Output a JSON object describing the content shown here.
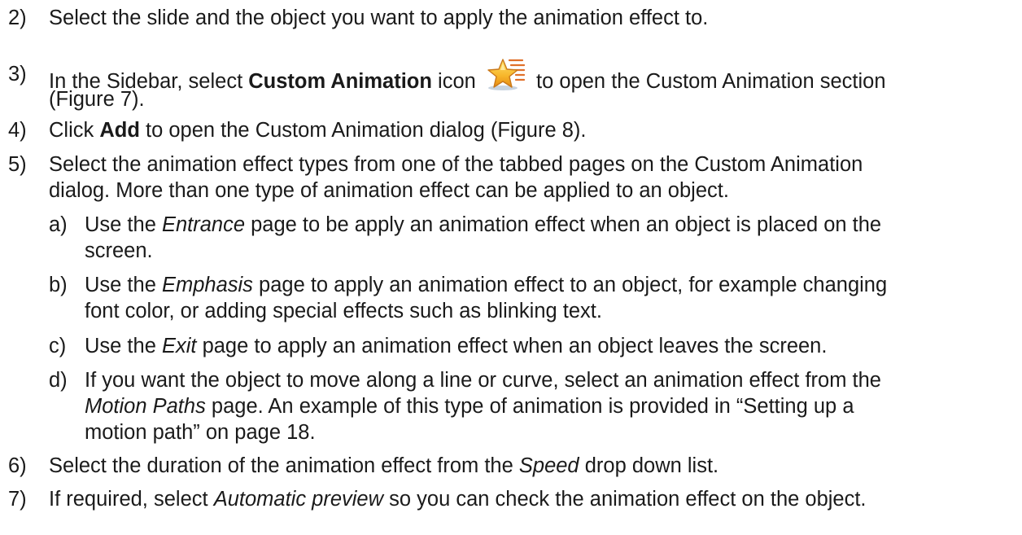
{
  "steps": [
    {
      "num": "2)",
      "text": "Select the slide and the object you want to apply the animation effect to."
    },
    {
      "num": "3)",
      "line1_a": "In the Sidebar, select ",
      "line1_b": "Custom Animation",
      "line1_c": " icon",
      "line1_d": "to open the Custom Animation section",
      "line2": "(Figure 7).",
      "icon": "custom-animation-star-icon"
    },
    {
      "num": "4)",
      "a": "Click ",
      "b": "Add",
      "c": " to open the Custom Animation dialog (Figure 8)."
    },
    {
      "num": "5)",
      "line1": "Select the animation effect types from one of the tabbed pages on the Custom Animation",
      "line2": "dialog. More than one type of animation effect can be applied to an object."
    },
    {
      "num": "6)",
      "a": "Select the duration of the animation effect from the ",
      "b": "Speed",
      "c": " drop down list."
    },
    {
      "num": "7)",
      "a": "If required, select ",
      "b": "Automatic preview",
      "c": " so you can check the animation effect on the object."
    }
  ],
  "substeps": [
    {
      "num": "a)",
      "line1_a": "Use the ",
      "line1_b": "Entrance",
      "line1_c": " page to be apply an animation effect when an object is placed on the",
      "line2": "screen."
    },
    {
      "num": "b)",
      "line1_a": "Use the ",
      "line1_b": "Emphasis",
      "line1_c": " page to apply an animation effect to an object, for example changing",
      "line2": "font color, or adding special effects such as blinking text."
    },
    {
      "num": "c)",
      "a": "Use the ",
      "b": "Exit",
      "c": " page to apply an animation effect when an object leaves the screen."
    },
    {
      "num": "d)",
      "line1": "If you want the object to move along a line or curve, select an animation effect from the",
      "line2_a": "Motion Paths",
      "line2_b": " page. An example of this type of animation is provided in “Setting up a",
      "line3": "motion path” on page 18."
    }
  ]
}
